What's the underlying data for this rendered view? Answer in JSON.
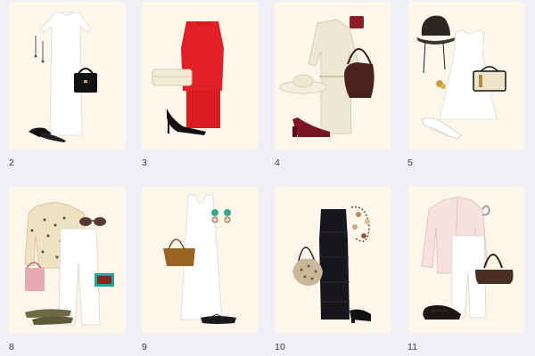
{
  "outfits": [
    {
      "number": "2",
      "items": [
        "earrings-icon",
        "white-maxi-dress-icon",
        "black-handbag-icon",
        "black-slide-sandals-icon"
      ]
    },
    {
      "number": "3",
      "items": [
        "red-top-icon",
        "red-skirt-icon",
        "cream-clutch-icon",
        "black-pumps-icon"
      ]
    },
    {
      "number": "4",
      "items": [
        "cream-trench-dress-icon",
        "wide-brim-hat-icon",
        "brown-shoulder-bag-icon",
        "burgundy-wallet-icon",
        "burgundy-heels-icon"
      ]
    },
    {
      "number": "5",
      "items": [
        "bucket-hat-icon",
        "white-sleeveless-dress-icon",
        "cream-crossbody-bag-icon",
        "gold-earring-icon",
        "white-mules-icon"
      ]
    },
    {
      "number": "8",
      "items": [
        "embellished-cardigan-icon",
        "white-wide-trousers-icon",
        "sunglasses-icon",
        "pink-bag-icon",
        "green-clutch-icon",
        "thong-sandals-icon"
      ]
    },
    {
      "number": "9",
      "items": [
        "white-tank-maxi-dress-icon",
        "tan-tote-icon",
        "drop-earrings-icon",
        "black-flip-flops-icon"
      ]
    },
    {
      "number": "10",
      "items": [
        "black-strapless-dress-icon",
        "snakeskin-hobo-bag-icon",
        "beaded-necklace-icon",
        "black-mules-icon"
      ]
    },
    {
      "number": "11",
      "items": [
        "pink-oversized-shirt-icon",
        "white-trousers-icon",
        "ear-cuff-icon",
        "dark-brown-baguette-bag-icon",
        "black-loafers-icon"
      ]
    }
  ],
  "colors": {
    "page_bg": "#eef0f5",
    "card_bg": "#fdf6ea",
    "label": "#3a3a3a"
  }
}
